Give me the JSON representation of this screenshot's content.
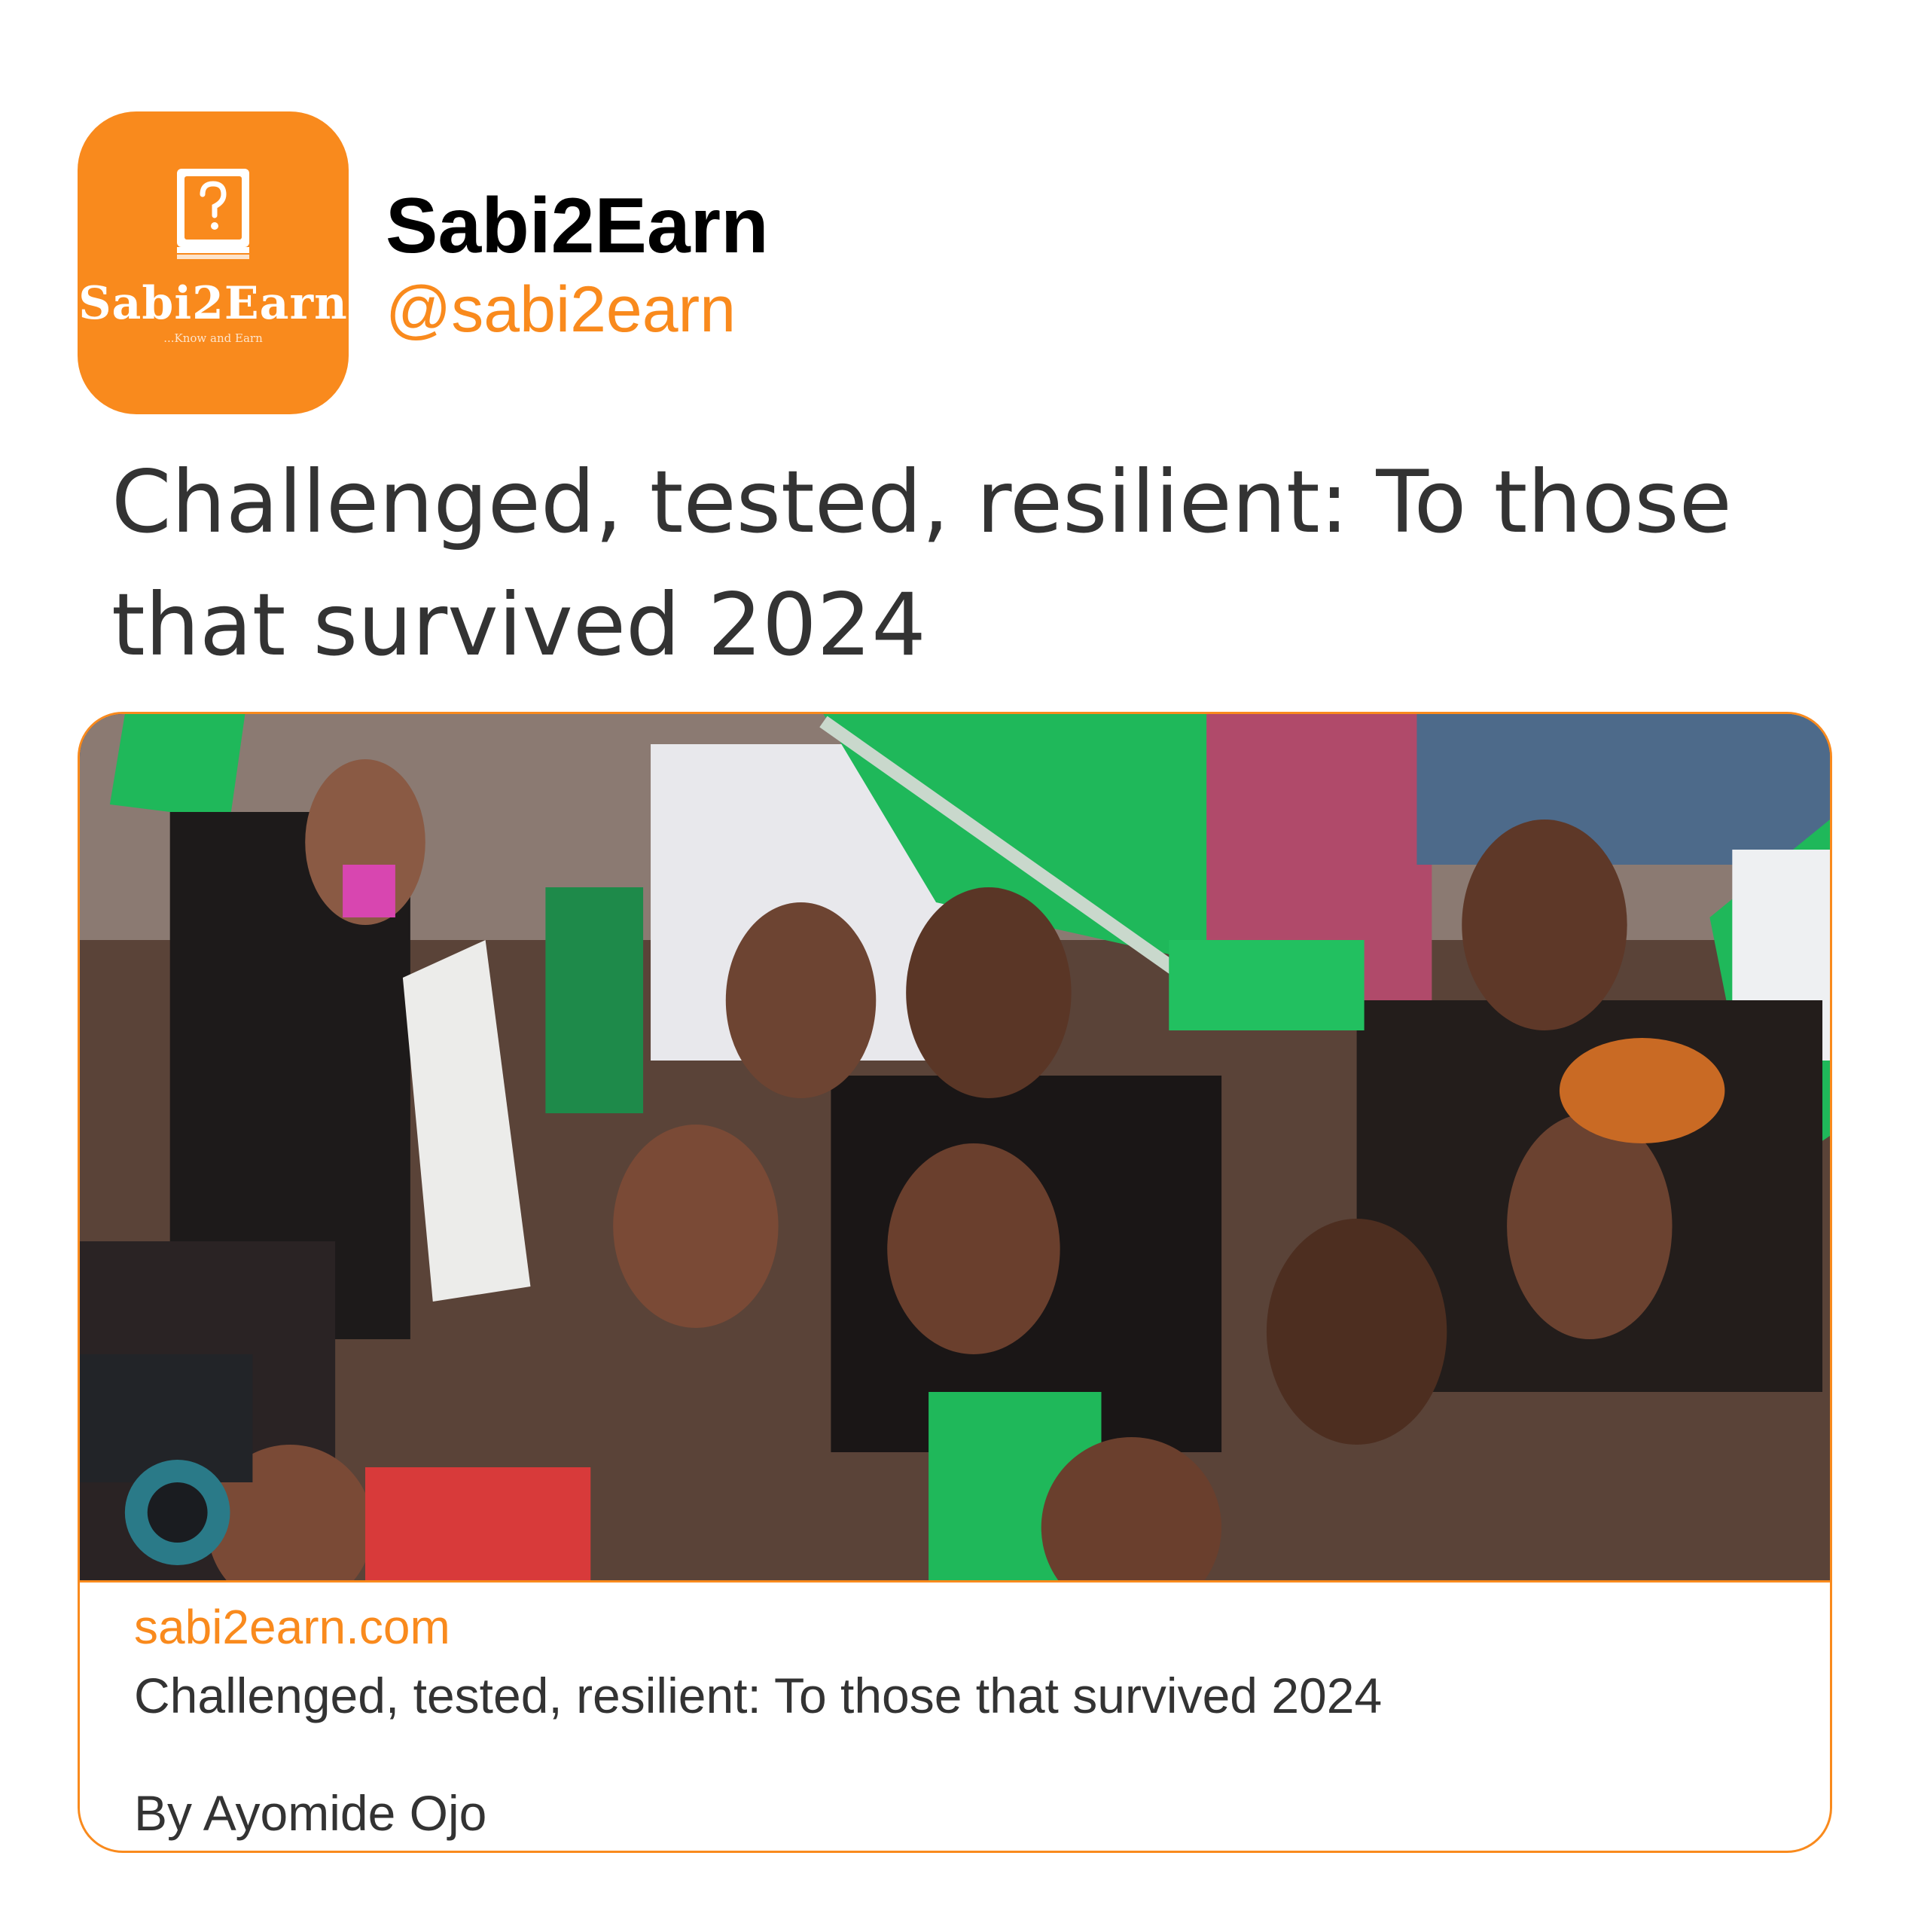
{
  "account": {
    "name": "Sabi2Earn",
    "handle": "@sabi2earn",
    "avatar_logo_text": "Sabi2Earn",
    "avatar_tagline": "...Know and Earn",
    "avatar_icon": "book-question-icon"
  },
  "post": {
    "text": "Challenged, tested, resilient: To those that survived 2024"
  },
  "link_card": {
    "domain": "sabi2earn.com",
    "title": "Challenged, tested, resilient: To those that survived 2024",
    "byline": "By Ayomide Ojo"
  },
  "colors": {
    "brand_orange": "#f98a1d",
    "text_dark": "#333333",
    "flag_green": "#1fb85a"
  }
}
